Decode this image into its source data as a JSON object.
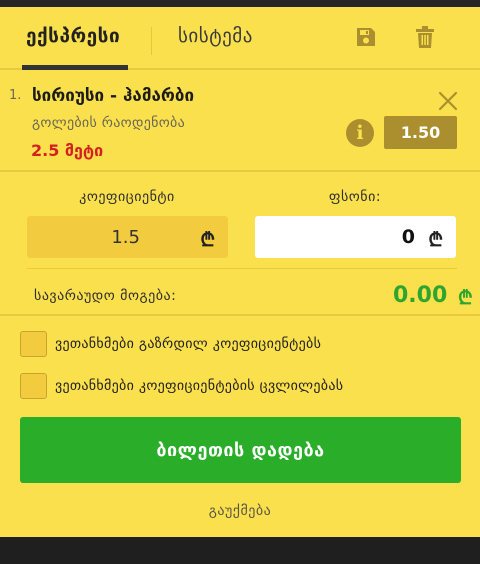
{
  "tabs": {
    "express": "ექსპრესი",
    "system": "სისტემა"
  },
  "toolbar": {
    "save_icon": "save-icon",
    "trash_icon": "trash-icon"
  },
  "bet": {
    "index": "1.",
    "title": "სირიუსი - ჰამარბი",
    "market": "გოლების რაოდენობა",
    "outcome": "2.5 მეტი",
    "odds": "1.50",
    "info_icon": "i"
  },
  "coefficient": {
    "label": "კოეფიციენტი",
    "value": "1.5",
    "currency": "₾"
  },
  "stake": {
    "label": "ფსონი:",
    "value": "0",
    "currency": "₾"
  },
  "possible_win": {
    "label": "სავარაუდო მოგება:",
    "value": "0.00",
    "currency": "₾"
  },
  "options": {
    "accept_increased": "ვეთანხმები გაზრდილ კოეფიციენტებს",
    "accept_changes": "ვეთანხმები კოეფიციენტების ცვლილებას"
  },
  "actions": {
    "place_bet": "ბილეთის დადება",
    "cancel": "გაუქმება"
  },
  "colors": {
    "panel": "#fbe04d",
    "accent_dark": "#ab8f2e",
    "red": "#d42020",
    "green": "#2aad28"
  }
}
